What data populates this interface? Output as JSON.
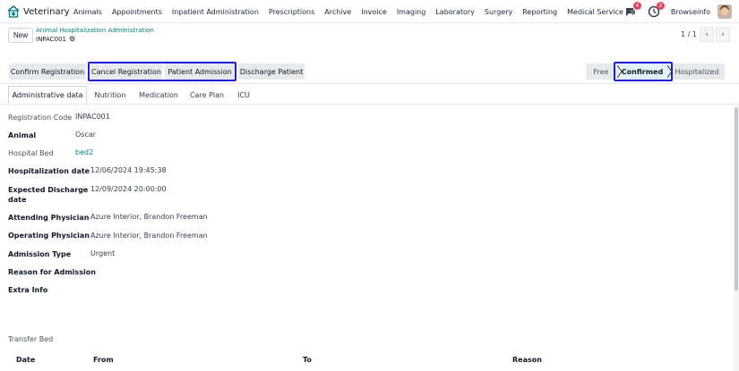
{
  "navbar": {
    "app_name": "Veterinary",
    "menu": [
      "Animals",
      "Appointments",
      "Inpatient Administration",
      "Prescriptions",
      "Archive",
      "Invoice",
      "Imaging",
      "Laboratory",
      "Surgery",
      "Reporting",
      "Medical Service"
    ],
    "messages_count": "4",
    "activities_count": "2",
    "company": "Browseinfo"
  },
  "control": {
    "new_label": "New",
    "breadcrumb_parent": "Animal Hospitalization Administration",
    "breadcrumb_current": "INPAC001",
    "pager": "1 / 1"
  },
  "statusbar": {
    "buttons": [
      "Confirm Registration",
      "Cancel Registration",
      "Patient Admission",
      "Discharge Patient"
    ],
    "stages": [
      "Free",
      "Confirmed",
      "Hospitalized"
    ],
    "active_stage": "Confirmed"
  },
  "tabs": [
    "Administrative data",
    "Nutrition",
    "Medication",
    "Care Plan",
    "ICU"
  ],
  "active_tab": "Administrative data",
  "fields": {
    "registration_code": {
      "label": "Registration Code",
      "value": "INPAC001"
    },
    "animal": {
      "label": "Animal",
      "value": "Oscar"
    },
    "hospital_bed": {
      "label": "Hospital Bed",
      "value": "bed2"
    },
    "hospitalization_date": {
      "label": "Hospitalization date",
      "value": "12/06/2024 19:45:38"
    },
    "expected_discharge_date": {
      "label_line1": "Expected Discharge",
      "label_line2": "date",
      "value": "12/09/2024 20:00:00"
    },
    "attending_physician": {
      "label": "Attending Physician",
      "value": "Azure Interior, Brandon Freeman"
    },
    "operating_physician": {
      "label": "Operating Physician",
      "value": "Azure Interior, Brandon Freeman"
    },
    "admission_type": {
      "label": "Admission Type",
      "value": "Urgent"
    },
    "reason_for_admission": {
      "label": "Reason for Admission",
      "value": ""
    },
    "extra_info": {
      "label": "Extra Info",
      "value": ""
    }
  },
  "transfer": {
    "title": "Transfer Bed",
    "columns": [
      "Date",
      "From",
      "To",
      "Reason"
    ]
  },
  "colors": {
    "accent": "#017e84",
    "highlight": "#1d1fd6",
    "badge": "#e3455e",
    "button_bg": "#e7e9ed"
  }
}
